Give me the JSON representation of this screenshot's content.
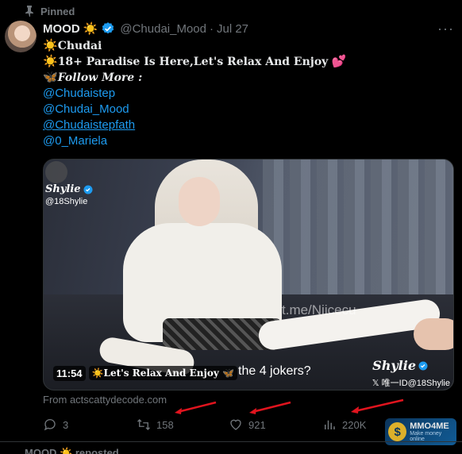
{
  "pinned": {
    "label": "Pinned"
  },
  "author": {
    "name": "MOOD",
    "handle": "@Chudai_Mood",
    "separator": "·",
    "date": "Jul 27",
    "more": "···"
  },
  "post": {
    "line1": "Chudai",
    "line2": "18+ Paradise Is Here,Let's Relax And Enjoy",
    "line3": "Follow More :",
    "mentions": [
      "@Chudaistep",
      "@Chudai_Mood",
      "@Chudaistepfath",
      "@0_Mariela"
    ]
  },
  "media": {
    "wm_name": "Shylie",
    "wm_handle": "@18Shylie",
    "wm_tg": "t.me/Niicecu",
    "wm_br_name": "Shylie",
    "wm_br_handle": "𝕏 唯一ID@18Shylie",
    "duration": "11:54",
    "caption_left": "Let's Relax And Enjoy",
    "caption_right": "the 4 jokers?"
  },
  "source": {
    "text": "From actscattydecode.com"
  },
  "actions": {
    "replies": "3",
    "reposts": "158",
    "likes": "921",
    "views": "220K"
  },
  "watermark": {
    "title": "MMO4ME",
    "subtitle": "Make money online"
  },
  "next": {
    "text": "MOOD ☀️ reposted"
  },
  "colors": {
    "accent": "#1d9bf0",
    "muted": "#71767b",
    "arrow": "#e0141e",
    "background": "#000000"
  }
}
